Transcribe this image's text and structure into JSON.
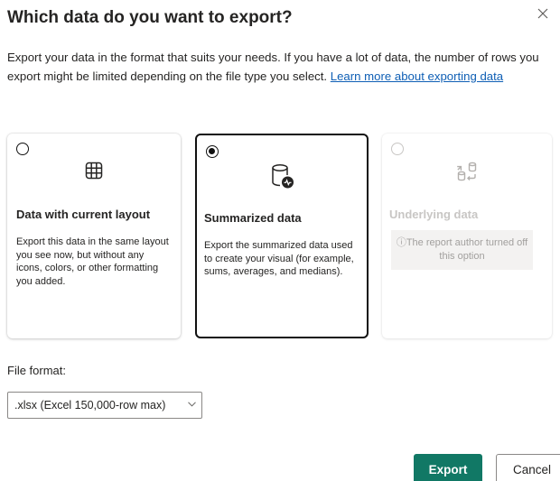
{
  "dialog": {
    "title": "Which data do you want to export?",
    "description": "Export your data in the format that suits your needs. If you have a lot of data, the number of rows you export might be limited depending on the file type you select.",
    "learn_more_link": "Learn more about exporting data"
  },
  "options": [
    {
      "title": "Data with current layout",
      "description": "Export this data in the same layout you see now, but without any icons, colors, or other formatting you added.",
      "icon": "table-icon",
      "selected": false,
      "disabled": false
    },
    {
      "title": "Summarized data",
      "description": "Export the summarized data used to create your visual (for example, sums, averages, and medians).",
      "icon": "summarized-data-icon",
      "selected": true,
      "disabled": false
    },
    {
      "title": "Underlying data",
      "note": "The report author turned off this option",
      "icon": "underlying-data-icon",
      "selected": false,
      "disabled": true
    }
  ],
  "file_format": {
    "label": "File format:",
    "selected": ".xlsx (Excel 150,000-row max)"
  },
  "buttons": {
    "export": "Export",
    "cancel": "Cancel"
  },
  "colors": {
    "primary": "#117865",
    "link": "#0f5fb5",
    "disabled_text": "#c8c6c4"
  }
}
